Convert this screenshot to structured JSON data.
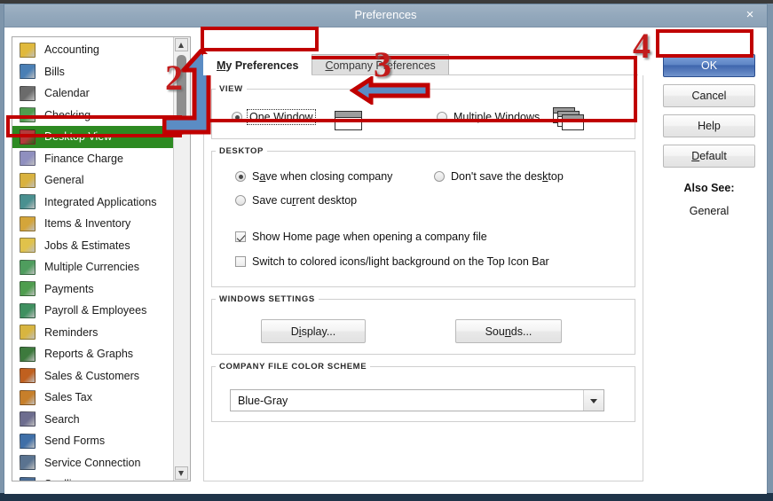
{
  "window": {
    "title": "Preferences",
    "close_label": "×"
  },
  "sidebar": {
    "items": [
      {
        "label": "Accounting",
        "icon": "accounting-icon",
        "color": "#e0b93c",
        "selected": false
      },
      {
        "label": "Bills",
        "icon": "bills-icon",
        "color": "#4a7fb5",
        "selected": false
      },
      {
        "label": "Calendar",
        "icon": "calendar-icon",
        "color": "#6b6b6b",
        "selected": false
      },
      {
        "label": "Checking",
        "icon": "checking-icon",
        "color": "#4f9d4f",
        "selected": false
      },
      {
        "label": "Desktop View",
        "icon": "desktop-view-icon",
        "color": "#b33b3b",
        "selected": true
      },
      {
        "label": "Finance Charge",
        "icon": "finance-charge-icon",
        "color": "#8f8fbf",
        "selected": false
      },
      {
        "label": "General",
        "icon": "general-icon",
        "color": "#d9b23e",
        "selected": false
      },
      {
        "label": "Integrated Applications",
        "icon": "integrated-applications-icon",
        "color": "#4a9090",
        "selected": false
      },
      {
        "label": "Items & Inventory",
        "icon": "items-inventory-icon",
        "color": "#d4a53a",
        "selected": false
      },
      {
        "label": "Jobs & Estimates",
        "icon": "jobs-estimates-icon",
        "color": "#e0c24b",
        "selected": false
      },
      {
        "label": "Multiple Currencies",
        "icon": "multiple-currencies-icon",
        "color": "#4f9d5e",
        "selected": false
      },
      {
        "label": "Payments",
        "icon": "payments-icon",
        "color": "#4f9d4f",
        "selected": false
      },
      {
        "label": "Payroll & Employees",
        "icon": "payroll-employees-icon",
        "color": "#3f9060",
        "selected": false
      },
      {
        "label": "Reminders",
        "icon": "reminders-icon",
        "color": "#d8b540",
        "selected": false
      },
      {
        "label": "Reports & Graphs",
        "icon": "reports-graphs-icon",
        "color": "#3d7a3d",
        "selected": false
      },
      {
        "label": "Sales & Customers",
        "icon": "sales-customers-icon",
        "color": "#c0601f",
        "selected": false
      },
      {
        "label": "Sales Tax",
        "icon": "sales-tax-icon",
        "color": "#c77f2a",
        "selected": false
      },
      {
        "label": "Search",
        "icon": "search-icon",
        "color": "#6d6d8f",
        "selected": false
      },
      {
        "label": "Send Forms",
        "icon": "send-forms-icon",
        "color": "#3f6fa8",
        "selected": false
      },
      {
        "label": "Service Connection",
        "icon": "service-connection-icon",
        "color": "#5a7390",
        "selected": false
      },
      {
        "label": "Spelling",
        "icon": "spelling-icon",
        "color": "#4a6b93",
        "selected": false
      }
    ]
  },
  "tabs": [
    {
      "label": "My Preferences",
      "mnemonic": "M",
      "active": true
    },
    {
      "label": "Company Preferences",
      "mnemonic": "C",
      "active": false
    }
  ],
  "groups": {
    "view": {
      "legend": "VIEW",
      "options": [
        {
          "label": "One Window",
          "mnemonic": "O",
          "selected": true,
          "focused": true,
          "preview": "single-window-preview"
        },
        {
          "label": "Multiple Windows",
          "mnemonic": "u",
          "selected": false,
          "focused": false,
          "preview": "multi-window-preview"
        }
      ]
    },
    "desktop": {
      "legend": "DESKTOP",
      "radios": [
        {
          "label": "Save when closing company",
          "mnemonic": "a",
          "selected": true
        },
        {
          "label": "Don't save the desktop",
          "mnemonic": "k",
          "selected": false
        },
        {
          "label": "Save current desktop",
          "mnemonic": "r",
          "selected": false
        }
      ],
      "checkboxes": [
        {
          "label": "Show Home page when opening a company file",
          "checked": true
        },
        {
          "label": "Switch to colored icons/light background on the Top Icon Bar",
          "checked": false
        }
      ]
    },
    "windows_settings": {
      "legend": "WINDOWS SETTINGS",
      "buttons": [
        {
          "label": "Display...",
          "mnemonic": "i"
        },
        {
          "label": "Sounds...",
          "mnemonic": "n"
        }
      ]
    },
    "color_scheme": {
      "legend": "COMPANY FILE COLOR SCHEME",
      "selected_value": "Blue-Gray"
    }
  },
  "right_panel": {
    "buttons": [
      {
        "label": "OK",
        "primary": true,
        "mnemonic": ""
      },
      {
        "label": "Cancel",
        "primary": false,
        "mnemonic": ""
      },
      {
        "label": "Help",
        "primary": false,
        "mnemonic": ""
      },
      {
        "label": "Default",
        "primary": false,
        "mnemonic": "D"
      }
    ],
    "also_see_label": "Also See:",
    "also_see_link": "General"
  },
  "annotations": {
    "numbers": [
      {
        "text": "2",
        "for": "sidebar-scroll-step"
      },
      {
        "text": "3",
        "for": "view-option-step"
      },
      {
        "text": "4",
        "for": "ok-button-step"
      }
    ],
    "accent_color": "#c00000",
    "arrow_fill": "#5b8cc4"
  }
}
